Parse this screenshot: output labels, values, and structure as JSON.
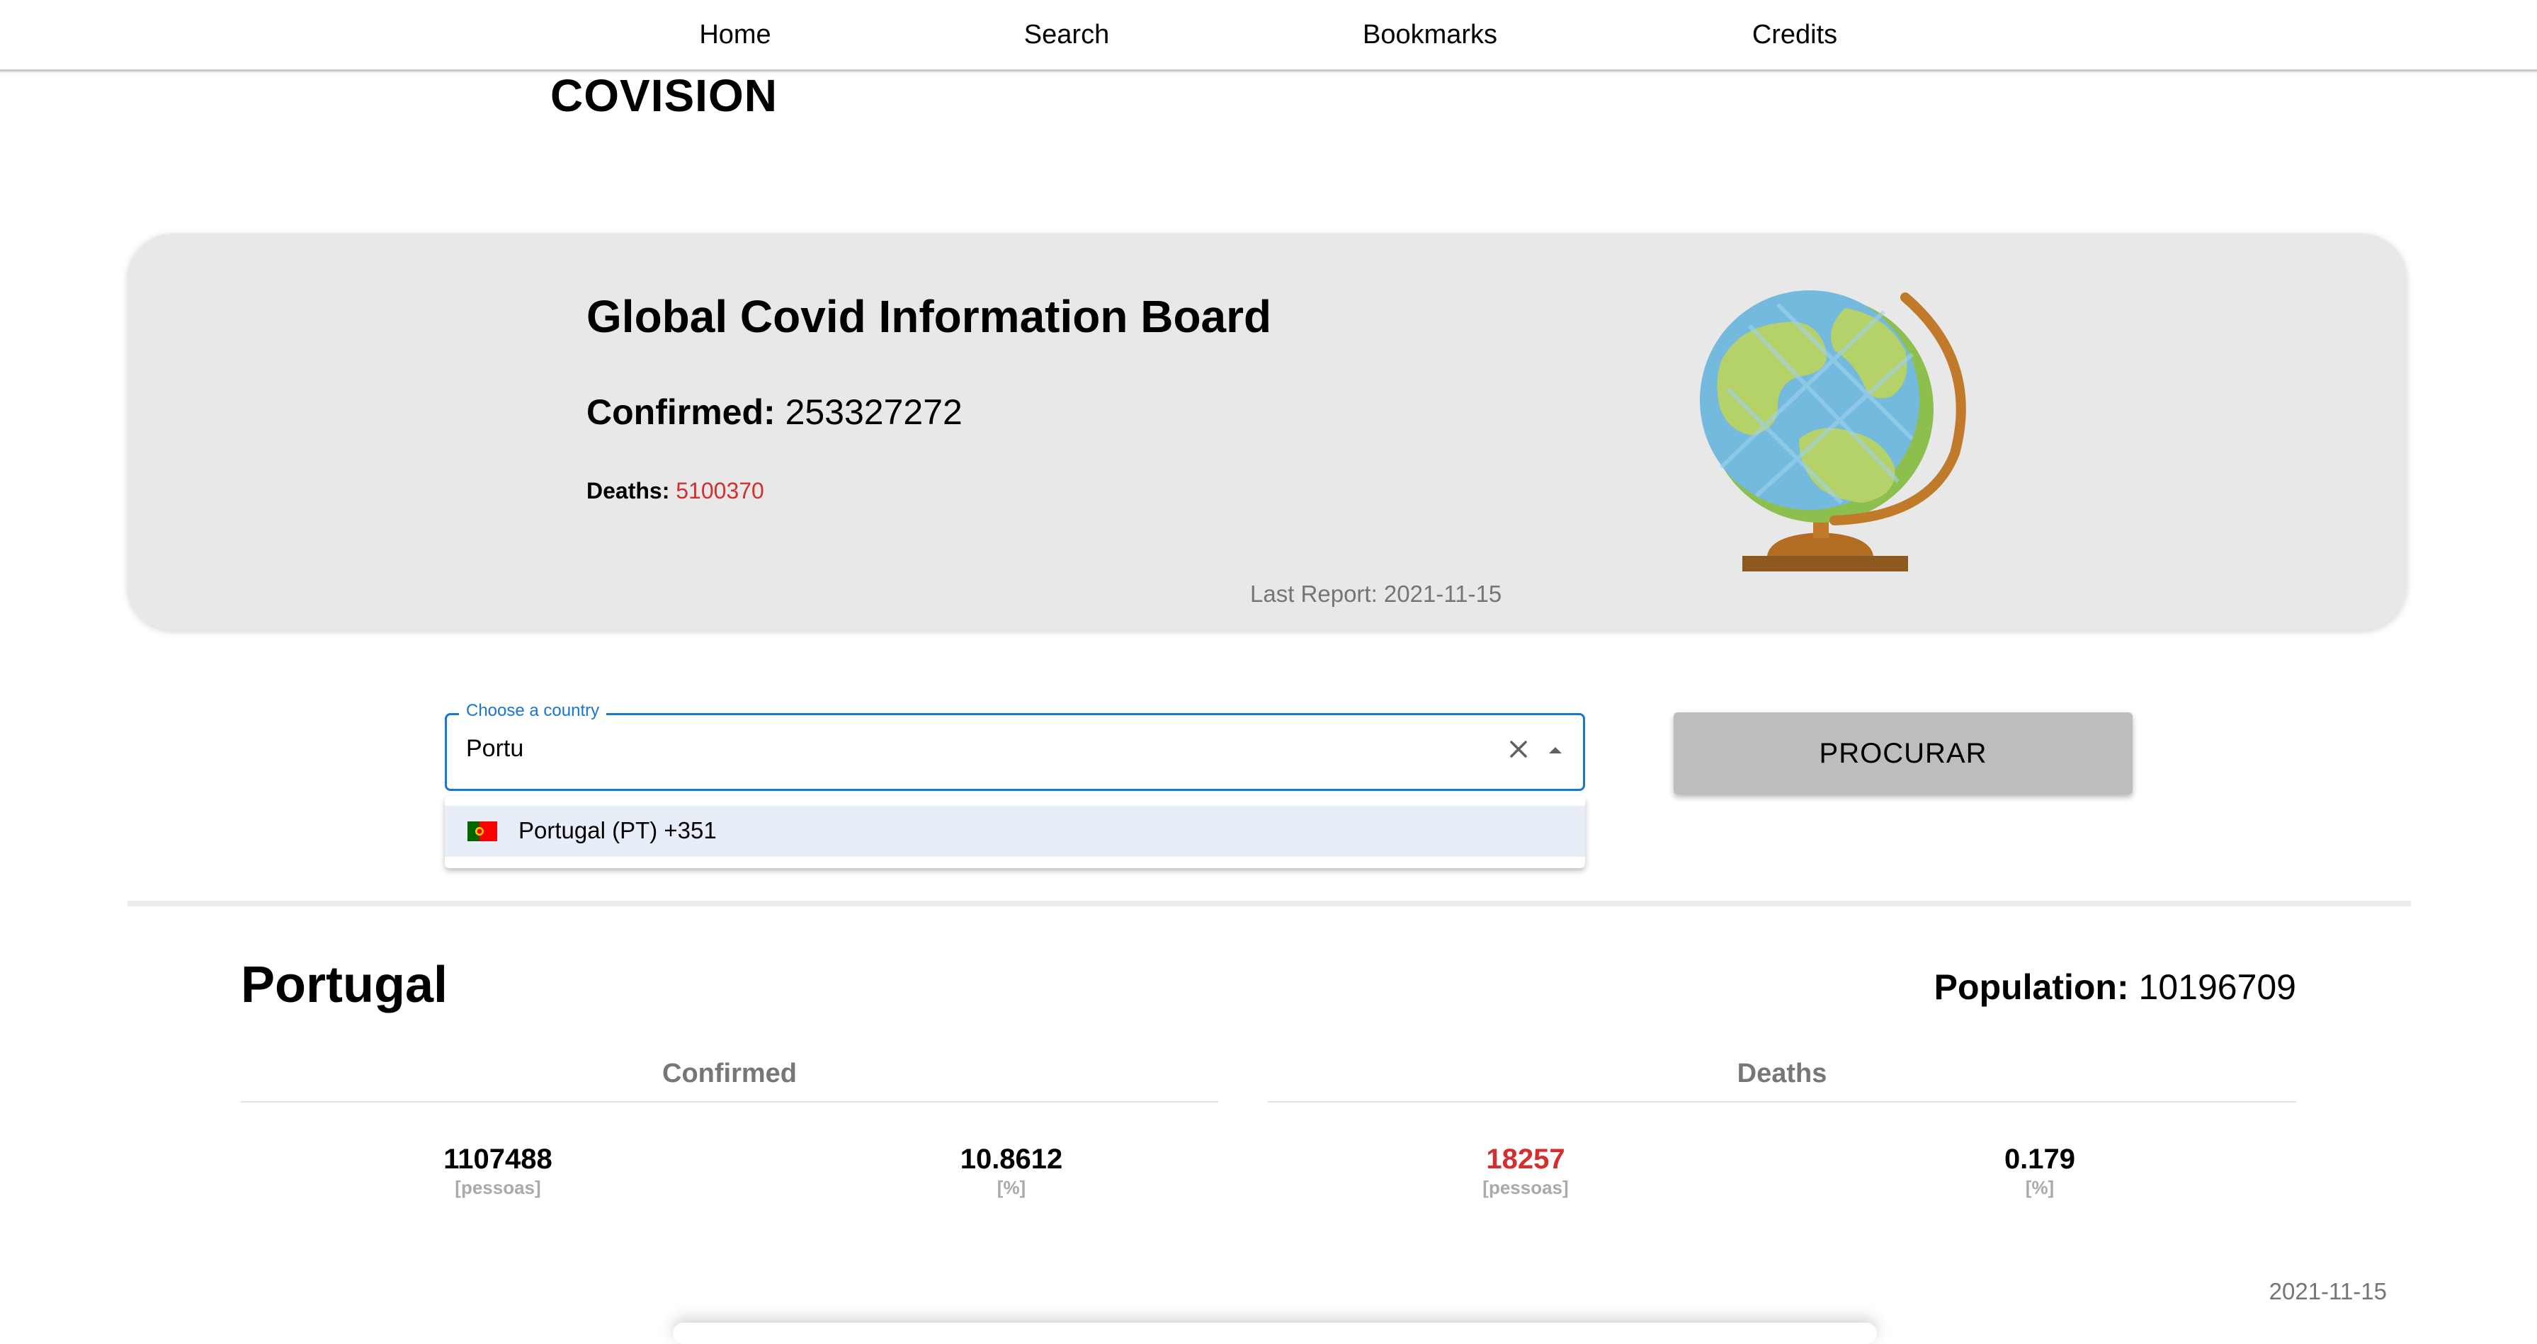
{
  "nav": {
    "items": [
      "Home",
      "Search",
      "Bookmarks",
      "Credits"
    ]
  },
  "logo": "COVISION",
  "hero": {
    "title": "Global Covid Information Board",
    "confirmed_label": "Confirmed:",
    "confirmed_value": "253327272",
    "deaths_label": "Deaths:",
    "deaths_value": "5100370",
    "last_report": "Last Report: 2021-11-15",
    "image": "globe-icon"
  },
  "search": {
    "label": "Choose a country",
    "value": "Portu",
    "option": "Portugal (PT) +351",
    "button": "PROCURAR"
  },
  "country": {
    "name": "Portugal",
    "population_label": "Population:",
    "population_value": "10196709",
    "confirmed_header": "Confirmed",
    "deaths_header": "Deaths",
    "stats": [
      {
        "value": "1107488",
        "unit": "[pessoas]"
      },
      {
        "value": "10.8612",
        "unit": "[%]"
      },
      {
        "value": "18257",
        "unit": "[pessoas]"
      },
      {
        "value": "0.179",
        "unit": "[%]"
      }
    ],
    "date": "2021-11-15"
  },
  "colors": {
    "accent": "#1976d2",
    "deaths": "#d32f2f",
    "card": "#e8e8e8",
    "button": "#bdbdbd"
  }
}
